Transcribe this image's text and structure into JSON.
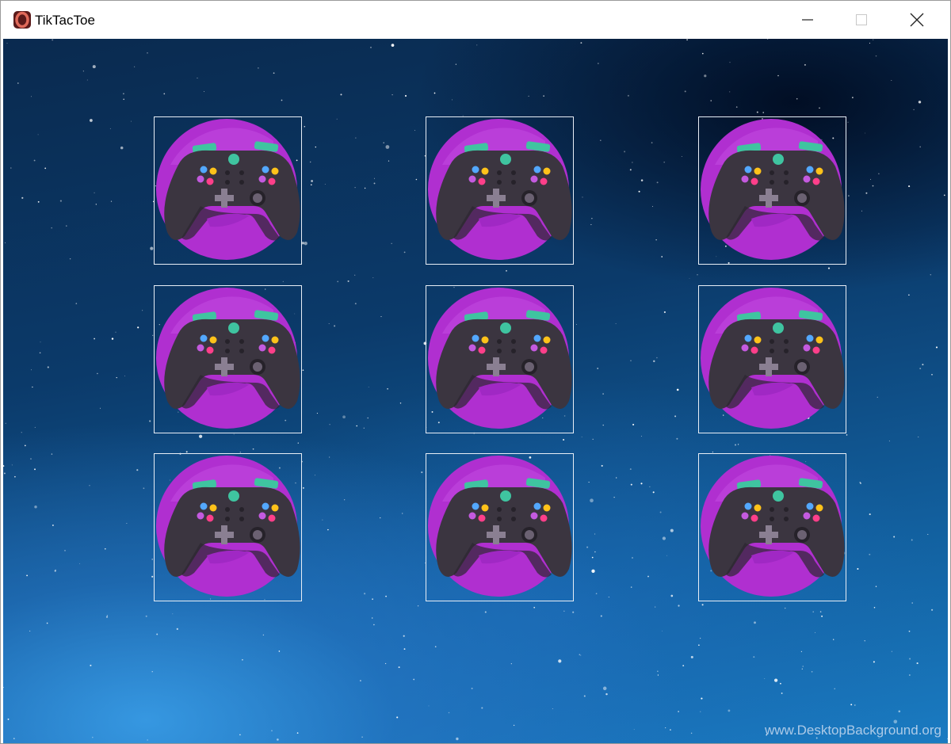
{
  "window": {
    "title": "TikTacToe",
    "app_icon": "opera-o-icon",
    "controls": [
      "minimize-icon",
      "maximize-icon",
      "close-icon"
    ]
  },
  "board": {
    "rows": 3,
    "cols": 3,
    "cell_icon": "gamepad-icon",
    "cell_state": [
      "",
      "",
      "",
      "",
      "",
      "",
      "",
      "",
      ""
    ]
  },
  "background": {
    "watermark": "www.DesktopBackground.org"
  },
  "colors": {
    "cell_border": "#e8eef6",
    "gamepad_circle": "#b02fd0",
    "gamepad_body": "#3b3540",
    "gamepad_accent": "#3fc4a0"
  }
}
